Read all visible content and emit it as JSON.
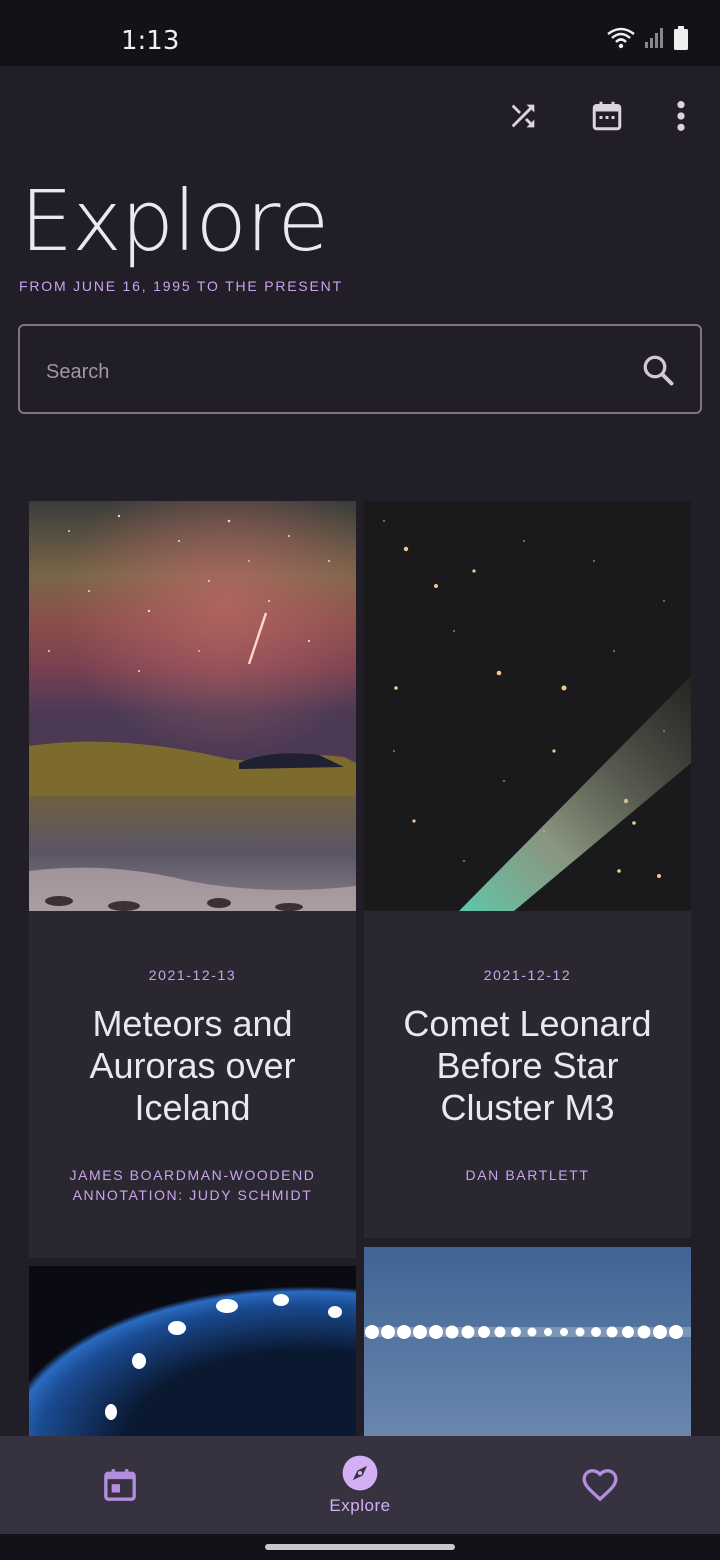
{
  "status_bar": {
    "time": "1:13"
  },
  "toolbar": {
    "shuffle_icon": "shuffle-icon",
    "calendar_icon": "calendar-icon",
    "more_icon": "more-vert-icon"
  },
  "header": {
    "title": "Explore",
    "subtitle": "FROM JUNE 16, 1995 TO THE PRESENT"
  },
  "search": {
    "placeholder": "Search",
    "value": ""
  },
  "cards": [
    {
      "date": "2021-12-13",
      "title": "Meteors and Auroras over Iceland",
      "credit_line1": "JAMES BOARDMAN-WOODEND",
      "credit_line2": "ANNOTATION: JUDY SCHMIDT"
    },
    {
      "date": "2021-12-12",
      "title": "Comet Leonard Before Star Cluster M3",
      "credit_line1": "DAN BARTLETT",
      "credit_line2": ""
    }
  ],
  "bottom_nav": {
    "items": [
      {
        "icon": "calendar-icon",
        "label": ""
      },
      {
        "icon": "compass-icon",
        "label": "Explore",
        "active": true
      },
      {
        "icon": "heart-icon",
        "label": ""
      }
    ]
  },
  "colors": {
    "background": "#211e27",
    "accent": "#c9a4ec",
    "nav_background": "#373240"
  }
}
